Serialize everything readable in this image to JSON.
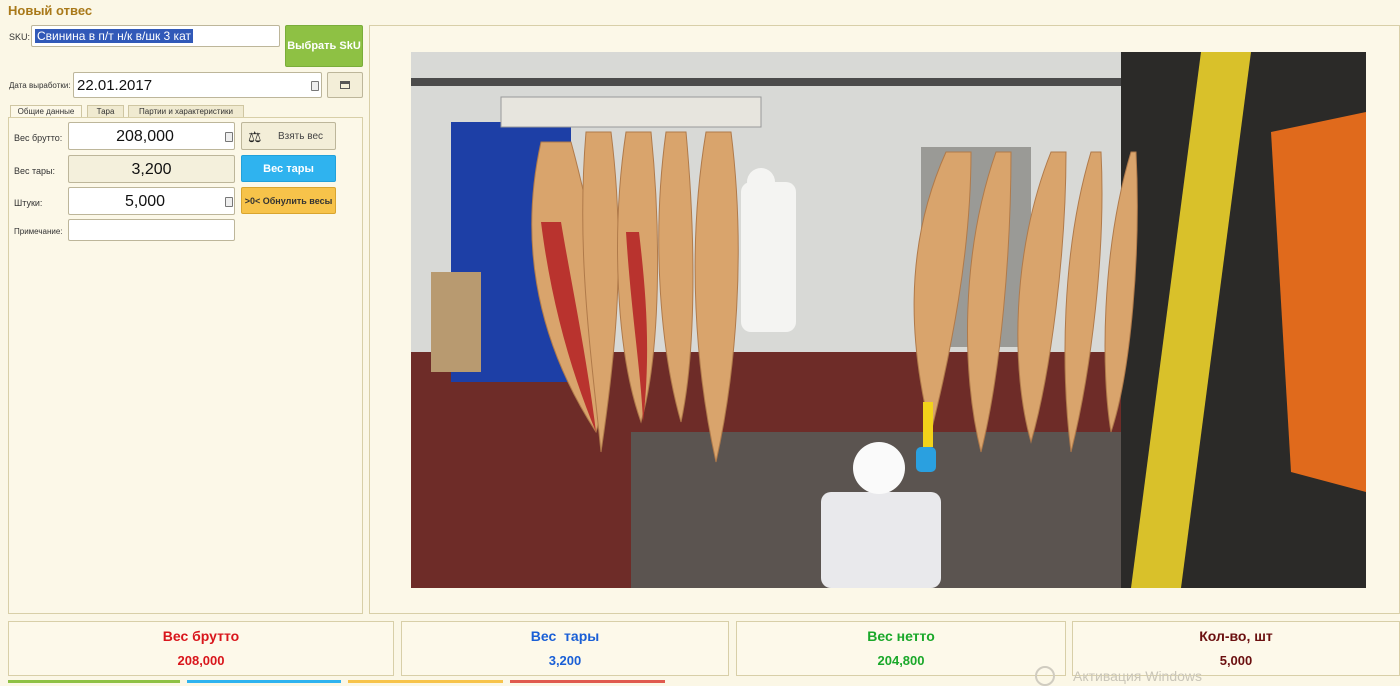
{
  "window": {
    "title": "Новый отвес"
  },
  "sku": {
    "label": "SKU:",
    "value": "Свинина в п/т н/к в/шк 3 кат",
    "select_button": "Выбрать SkU"
  },
  "production_date": {
    "label": "Дата выработки:",
    "value": "22.01.2017"
  },
  "tabs": [
    {
      "label": "Общие данные",
      "active": true
    },
    {
      "label": "Тара",
      "active": false
    },
    {
      "label": "Партии и характеристики",
      "active": false
    }
  ],
  "gross_weight": {
    "label": "Вес брутто:",
    "value": "208,000",
    "button": "Взять вес"
  },
  "tare_weight": {
    "label": "Вес тары:",
    "value": "3,200",
    "button": "Вес тары"
  },
  "pieces": {
    "label": "Штуки:",
    "value": "5,000",
    "button": ">0< Обнулить весы"
  },
  "note": {
    "label": "Примечание:",
    "value": ""
  },
  "summary": [
    {
      "title": "Вес брутто",
      "value": "208,000",
      "color": "#d9161c"
    },
    {
      "title": "Вес  тары",
      "value": "3,200",
      "color": "#1a5fd6"
    },
    {
      "title": "Вес нетто",
      "value": "204,800",
      "color": "#1aa82a"
    },
    {
      "title": "Кол-во, шт",
      "value": "5,000",
      "color": "#6b1010"
    }
  ],
  "watermark": "Активация Windows",
  "colors": {
    "accent_title": "#a9791a",
    "green_button": "#8ec144",
    "blue_button": "#2fb3ef",
    "orange_button": "#f7c34a"
  }
}
